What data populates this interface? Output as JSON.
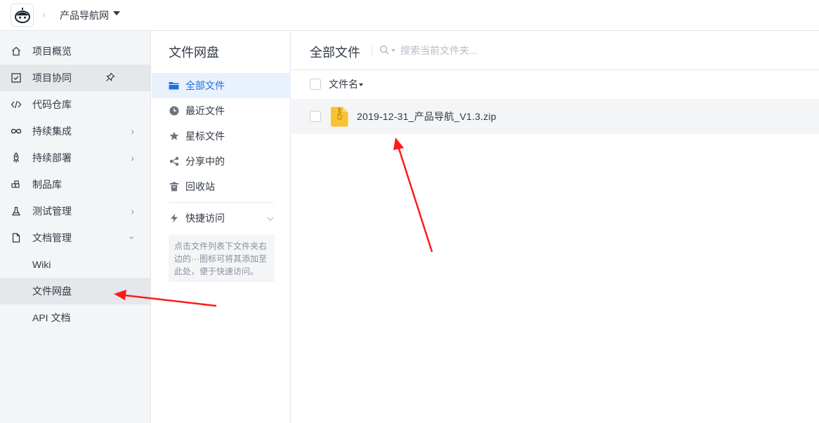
{
  "topbar": {
    "project_name": "产品导航网"
  },
  "sidebar": {
    "items": [
      {
        "label": "项目概览",
        "icon": "home-icon"
      },
      {
        "label": "项目协同",
        "icon": "checkbox-icon"
      },
      {
        "label": "代码仓库",
        "icon": "code-icon"
      },
      {
        "label": "持续集成",
        "icon": "infinity-icon"
      },
      {
        "label": "持续部署",
        "icon": "rocket-icon"
      },
      {
        "label": "制品库",
        "icon": "package-icon"
      },
      {
        "label": "测试管理",
        "icon": "flask-icon"
      },
      {
        "label": "文档管理",
        "icon": "document-icon"
      }
    ],
    "sub_items": [
      {
        "label": "Wiki"
      },
      {
        "label": "文件网盘"
      },
      {
        "label": "API 文档"
      }
    ]
  },
  "midpanel": {
    "title": "文件网盘",
    "items": [
      {
        "label": "全部文件",
        "icon": "folder-icon"
      },
      {
        "label": "最近文件",
        "icon": "clock-icon"
      },
      {
        "label": "星标文件",
        "icon": "star-icon"
      },
      {
        "label": "分享中的",
        "icon": "share-icon"
      },
      {
        "label": "回收站",
        "icon": "trash-icon"
      }
    ],
    "quick_access": {
      "label": "快捷访问",
      "hint": "点击文件列表下文件夹右边的···图标可将其添加至此处，便于快速访问。"
    }
  },
  "main": {
    "title": "全部文件",
    "search_placeholder": "搜索当前文件夹...",
    "column_name": "文件名",
    "files": [
      {
        "name": "2019-12-31_产品导航_V1.3.zip",
        "type": "zip"
      }
    ]
  },
  "colors": {
    "accent": "#1f6fde",
    "sidebar_bg": "#f4f5f7",
    "active_bg": "#e9f1fc",
    "zip_yellow": "#f8c233",
    "arrow_red": "#ff1a1a"
  }
}
